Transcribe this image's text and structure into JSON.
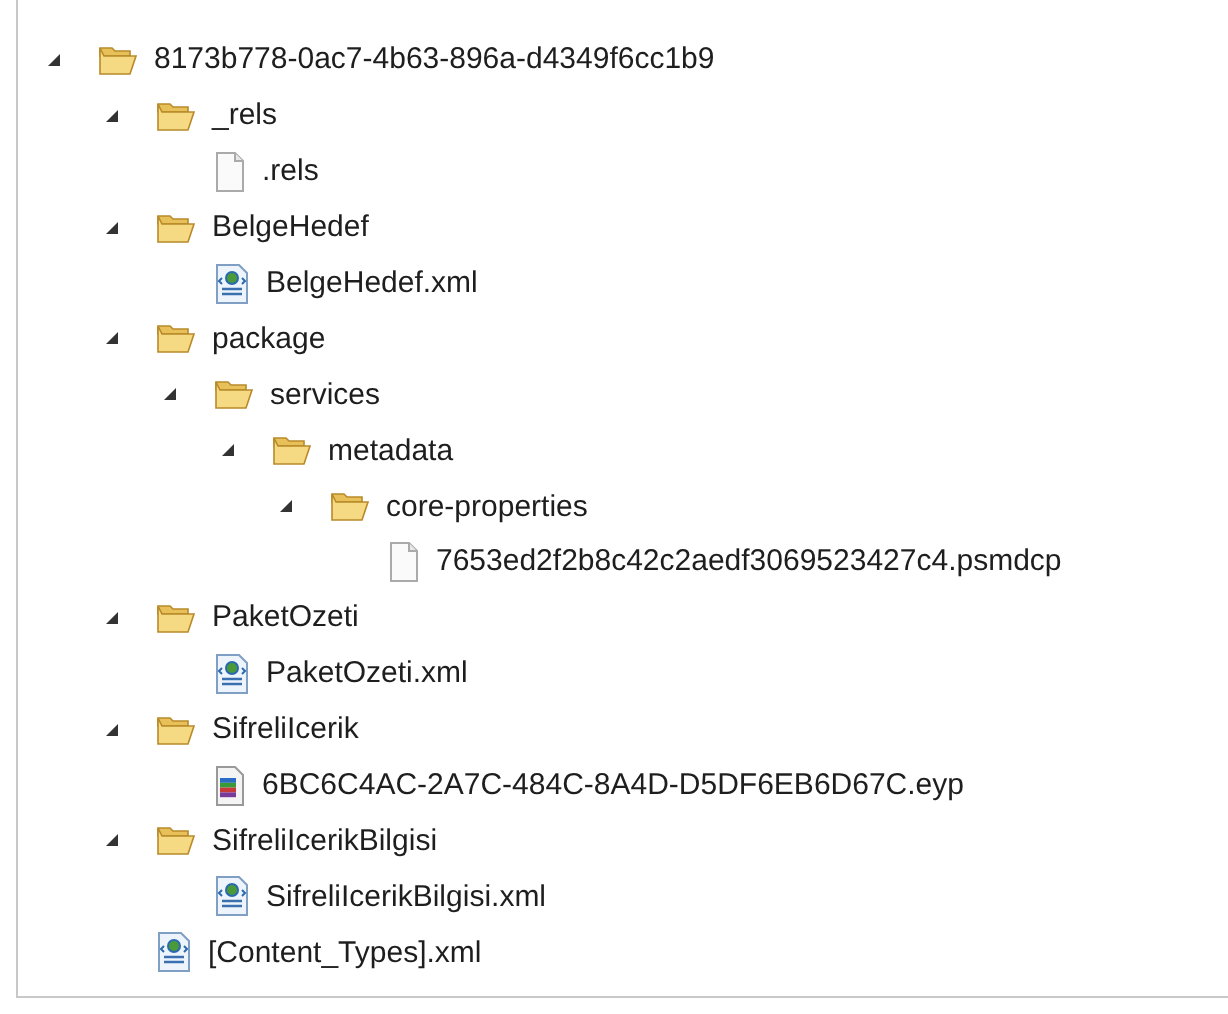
{
  "tree": [
    {
      "label": "8173b778-0ac7-4b63-896a-d4349f6cc1b9",
      "kind": "folder",
      "expanded": true,
      "children": [
        {
          "label": "_rels",
          "kind": "folder",
          "expanded": true,
          "children": [
            {
              "label": ".rels",
              "kind": "file"
            }
          ]
        },
        {
          "label": "BelgeHedef",
          "kind": "folder",
          "expanded": true,
          "children": [
            {
              "label": "BelgeHedef.xml",
              "kind": "xml"
            }
          ]
        },
        {
          "label": "package",
          "kind": "folder",
          "expanded": true,
          "children": [
            {
              "label": "services",
              "kind": "folder",
              "expanded": true,
              "children": [
                {
                  "label": "metadata",
                  "kind": "folder",
                  "expanded": true,
                  "children": [
                    {
                      "label": "core-properties",
                      "kind": "folder",
                      "expanded": true,
                      "children": [
                        {
                          "label": "7653ed2f2b8c42c2aedf3069523427c4.psmdcp",
                          "kind": "file"
                        }
                      ]
                    }
                  ]
                }
              ]
            }
          ]
        },
        {
          "label": "PaketOzeti",
          "kind": "folder",
          "expanded": true,
          "children": [
            {
              "label": "PaketOzeti.xml",
              "kind": "xml"
            }
          ]
        },
        {
          "label": "SifreliIcerik",
          "kind": "folder",
          "expanded": true,
          "children": [
            {
              "label": "6BC6C4AC-2A7C-484C-8A4D-D5DF6EB6D67C.eyp",
              "kind": "archive"
            }
          ]
        },
        {
          "label": "SifreliIcerikBilgisi",
          "kind": "folder",
          "expanded": true,
          "children": [
            {
              "label": "SifreliIcerikBilgisi.xml",
              "kind": "xml"
            }
          ]
        },
        {
          "label": "[Content_Types].xml",
          "kind": "xml"
        }
      ]
    }
  ]
}
